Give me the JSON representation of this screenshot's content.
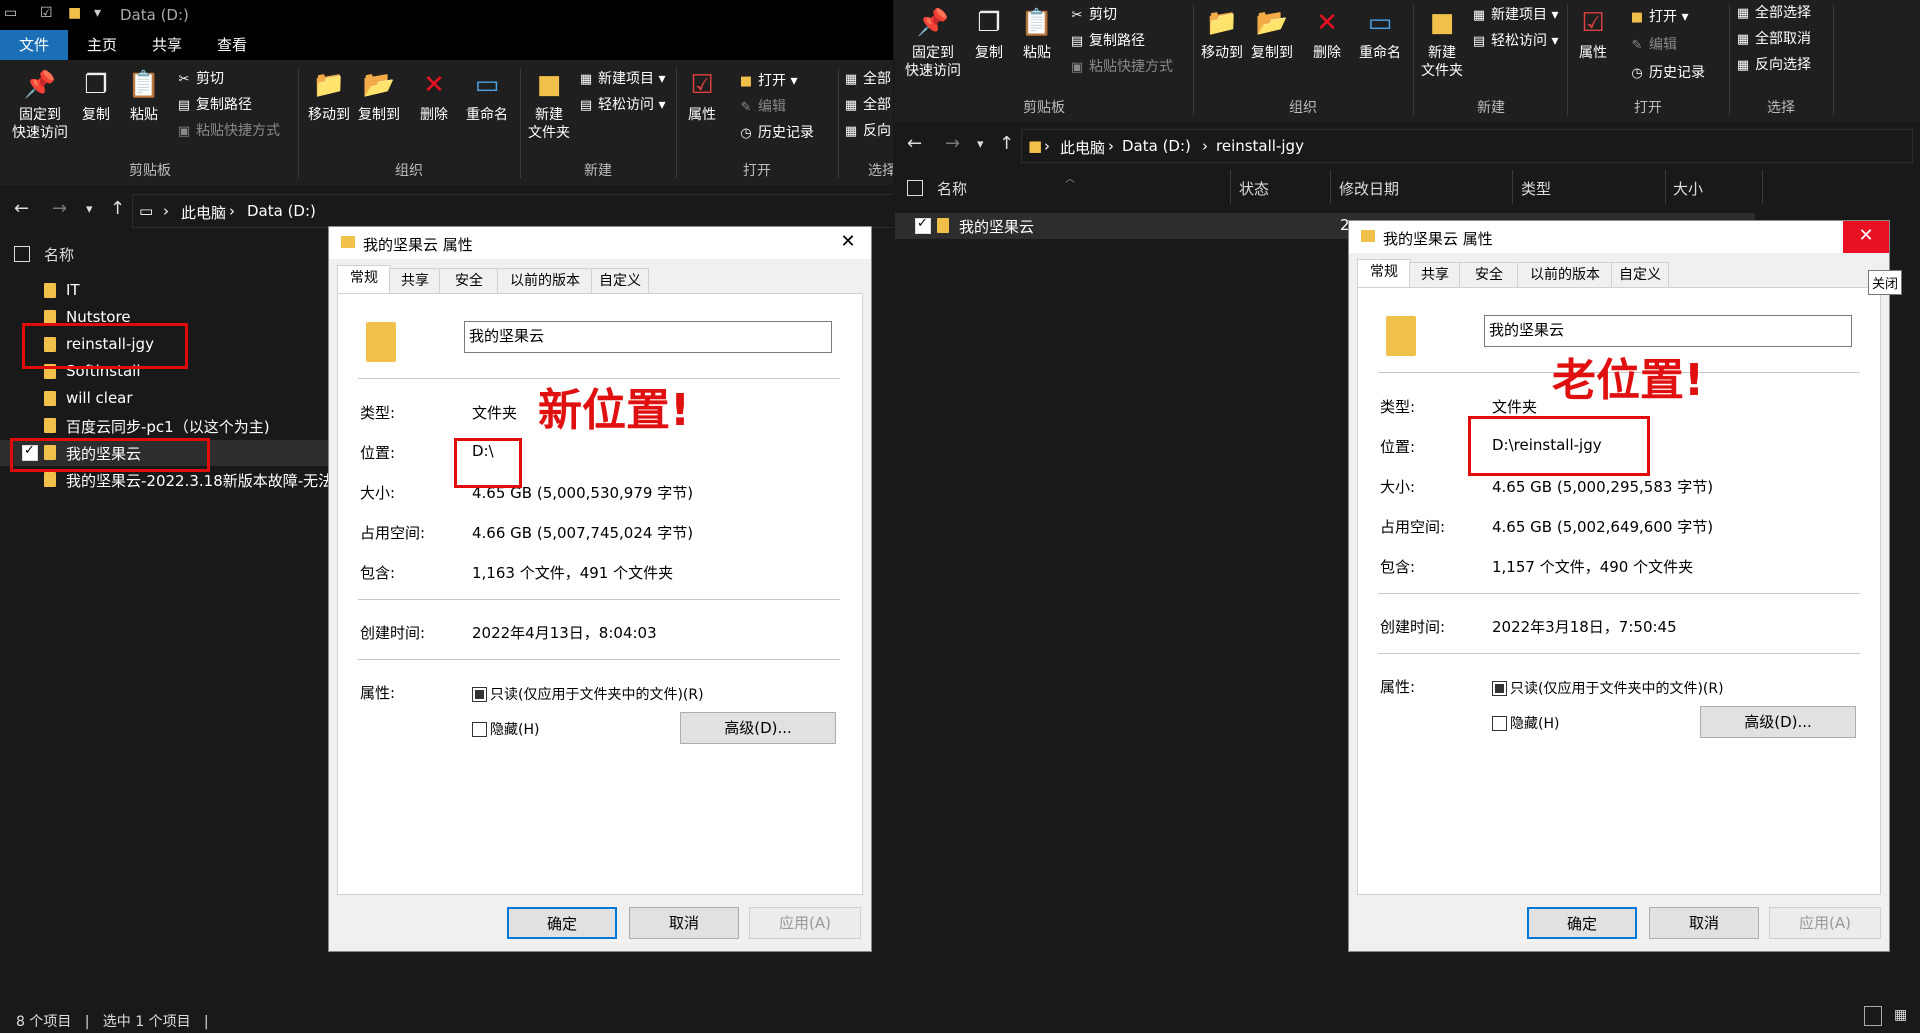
{
  "left": {
    "title": "Data (D:)",
    "tabs": [
      "文件",
      "主页",
      "共享",
      "查看"
    ],
    "ribbon": {
      "pin": "固定到\n快速访问",
      "copy": "复制",
      "paste": "粘贴",
      "cut": "剪切",
      "copy_path": "复制路径",
      "paste_shortcut": "粘贴快捷方式",
      "move_to": "移动到",
      "copy_to": "复制到",
      "delete": "删除",
      "rename": "重命名",
      "new_folder": "新建\n文件夹",
      "new_item": "新建项目",
      "easy_access": "轻松访问",
      "properties": "属性",
      "open": "打开",
      "edit": "编辑",
      "history": "历史记录",
      "select_all": "全部",
      "select_none": "全部",
      "invert": "反向",
      "groups": {
        "clipboard": "剪贴板",
        "organize": "组织",
        "new": "新建",
        "open": "打开",
        "select": "选择"
      }
    },
    "breadcrumb": [
      "此电脑",
      "Data (D:)"
    ],
    "column_name": "名称",
    "files": [
      "IT",
      "Nutstore",
      "reinstall-jgy",
      "Softinstall",
      "will clear",
      "百度云同步-pc1（以这个为主)",
      "我的坚果云",
      "我的坚果云-2022.3.18新版本故障-无法"
    ],
    "status": "8 个项目   |   选中 1 个项目   |"
  },
  "right": {
    "ribbon": {
      "pin": "固定到\n快速访问",
      "copy": "复制",
      "paste": "粘贴",
      "cut": "剪切",
      "copy_path": "复制路径",
      "paste_shortcut": "粘贴快捷方式",
      "move_to": "移动到",
      "copy_to": "复制到",
      "delete": "删除",
      "rename": "重命名",
      "new_folder": "新建\n文件夹",
      "new_item": "新建项目",
      "easy_access": "轻松访问",
      "properties": "属性",
      "open": "打开",
      "edit": "编辑",
      "history": "历史记录",
      "select_all": "全部选择",
      "select_none": "全部取消",
      "invert": "反向选择",
      "groups": {
        "clipboard": "剪贴板",
        "organize": "组织",
        "new": "新建",
        "open": "打开",
        "select": "选择"
      }
    },
    "breadcrumb": [
      "此电脑",
      "Data (D:)",
      "reinstall-jgy"
    ],
    "columns": [
      "名称",
      "状态",
      "修改日期",
      "类型",
      "大小"
    ],
    "files": [
      "我的坚果云"
    ],
    "date_partial": "2"
  },
  "dialog_new": {
    "title": "我的坚果云 属性",
    "tabs": [
      "常规",
      "共享",
      "安全",
      "以前的版本",
      "自定义"
    ],
    "name": "我的坚果云",
    "type_label": "类型:",
    "type": "文件夹",
    "location_label": "位置:",
    "location": "D:\\",
    "size_label": "大小:",
    "size": "4.65 GB (5,000,530,979 字节)",
    "disk_label": "占用空间:",
    "disk": "4.66 GB (5,007,745,024 字节)",
    "contains_label": "包含:",
    "contains": "1,163 个文件，491 个文件夹",
    "created_label": "创建时间:",
    "created": "2022年4月13日，8:04:03",
    "attr_label": "属性:",
    "readonly": "只读(仅应用于文件夹中的文件)(R)",
    "hidden": "隐藏(H)",
    "advanced": "高级(D)...",
    "ok": "确定",
    "cancel": "取消",
    "apply": "应用(A)",
    "annotation": "新位置!"
  },
  "dialog_old": {
    "title": "我的坚果云 属性",
    "tabs": [
      "常规",
      "共享",
      "安全",
      "以前的版本",
      "自定义"
    ],
    "name": "我的坚果云",
    "type_label": "类型:",
    "type": "文件夹",
    "location_label": "位置:",
    "location": "D:\\reinstall-jgy",
    "size_label": "大小:",
    "size": "4.65 GB (5,000,295,583 字节)",
    "disk_label": "占用空间:",
    "disk": "4.65 GB (5,002,649,600 字节)",
    "contains_label": "包含:",
    "contains": "1,157 个文件，490 个文件夹",
    "created_label": "创建时间:",
    "created": "2022年3月18日，7:50:45",
    "attr_label": "属性:",
    "readonly": "只读(仅应用于文件夹中的文件)(R)",
    "hidden": "隐藏(H)",
    "advanced": "高级(D)...",
    "ok": "确定",
    "cancel": "取消",
    "apply": "应用(A)",
    "annotation": "老位置!",
    "close_tooltip": "关闭"
  }
}
